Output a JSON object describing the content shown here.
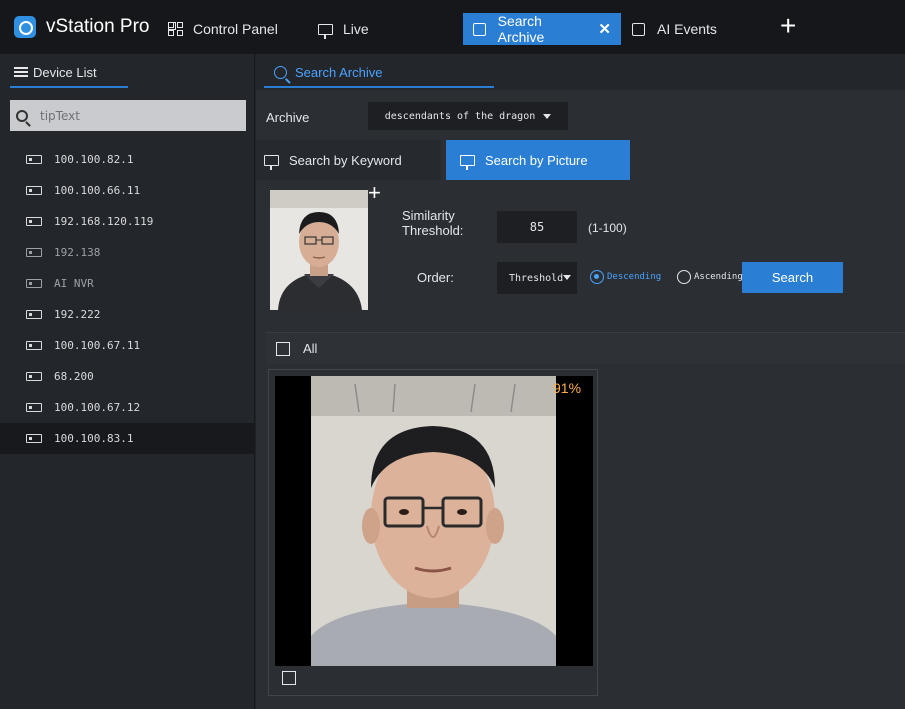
{
  "app": {
    "title": "vStation Pro"
  },
  "tabs": [
    {
      "label": "Control Panel",
      "icon": "grid-icon"
    },
    {
      "label": "Live",
      "icon": "monitor-icon"
    },
    {
      "label": "Search Archive",
      "icon": "ai-search-icon",
      "active": true,
      "close": "✕"
    },
    {
      "label": "AI Events",
      "icon": "ai-search-icon"
    }
  ],
  "new_tab": "+",
  "sidebar": {
    "title": "Device List",
    "search_placeholder": "tipText",
    "devices": [
      {
        "label": "100.100.82.1",
        "online": true
      },
      {
        "label": "100.100.66.11",
        "online": true
      },
      {
        "label": "192.168.120.119",
        "online": true
      },
      {
        "label": "192.138",
        "online": false
      },
      {
        "label": "AI NVR",
        "online": false
      },
      {
        "label": "192.222",
        "online": true
      },
      {
        "label": "100.100.67.11",
        "online": true
      },
      {
        "label": "68.200",
        "online": true
      },
      {
        "label": "100.100.67.12",
        "online": true
      },
      {
        "label": "100.100.83.1",
        "online": true,
        "selected": true
      }
    ]
  },
  "main": {
    "tab_label": "Search Archive",
    "archive_label": "Archive",
    "archive_value": "descendants of the dragon",
    "mode_keyword": "Search by Keyword",
    "mode_picture": "Search by Picture",
    "similarity_label": "Similarity Threshold:",
    "similarity_value": "85",
    "similarity_range": "(1-100)",
    "order_label": "Order:",
    "order_value": "Threshold",
    "descending": "Descending",
    "ascending": "Ascending",
    "search_button": "Search",
    "all_label": "All",
    "results": [
      {
        "score": "91%"
      }
    ]
  },
  "colors": {
    "accent": "#2a7fd4",
    "score": "#ffb04a",
    "background": "#2b2e33"
  }
}
